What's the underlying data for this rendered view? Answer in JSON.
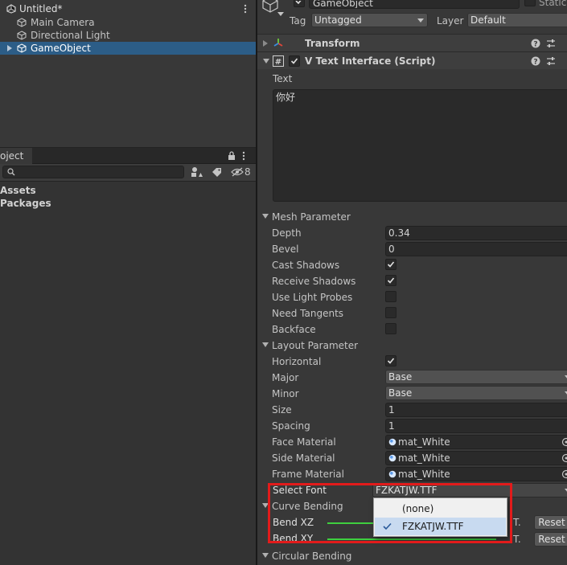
{
  "hierarchy": {
    "scene_name": "Untitled*",
    "items": [
      {
        "label": "Main Camera",
        "icon": "gameobject-cube-icon"
      },
      {
        "label": "Directional Light",
        "icon": "gameobject-cube-icon"
      },
      {
        "label": "GameObject",
        "icon": "gameobject-cube-icon",
        "selected": true
      }
    ]
  },
  "project": {
    "tab_label": "oject",
    "search_placeholder": "",
    "hidden_count": "8",
    "roots": [
      "Assets",
      "Packages"
    ]
  },
  "inspector": {
    "object_name": "GameObject",
    "static_label": "Static",
    "tag_label": "Tag",
    "tag_value": "Untagged",
    "layer_label": "Layer",
    "layer_value": "Default",
    "components": {
      "transform_title": "Transform",
      "script_title": "V Text Interface (Script)"
    },
    "text_label": "Text",
    "text_value": "你好",
    "mesh": {
      "header": "Mesh Parameter",
      "depth_label": "Depth",
      "depth_value": "0.34",
      "bevel_label": "Bevel",
      "bevel_value": "0",
      "cast_shadows_label": "Cast Shadows",
      "cast_shadows": true,
      "receive_shadows_label": "Receive Shadows",
      "receive_shadows": true,
      "light_probes_label": "Use Light Probes",
      "light_probes": false,
      "tangents_label": "Need Tangents",
      "tangents": false,
      "backface_label": "Backface",
      "backface": false
    },
    "layout": {
      "header": "Layout Parameter",
      "horizontal_label": "Horizontal",
      "horizontal": true,
      "major_label": "Major",
      "major_value": "Base",
      "minor_label": "Minor",
      "minor_value": "Base",
      "size_label": "Size",
      "size_value": "1",
      "spacing_label": "Spacing",
      "spacing_value": "1",
      "face_material_label": "Face Material",
      "face_material": "mat_White",
      "side_material_label": "Side Material",
      "side_material": "mat_White",
      "frame_material_label": "Frame Material",
      "frame_material": "mat_White",
      "select_font_label": "Select Font",
      "select_font_value": "FZKATJW.TTF"
    },
    "curve": {
      "header": "Curve Bending",
      "bend_xz_label": "Bend XZ",
      "bend_xy_label": "Bend XY",
      "curve_suffix": "T.",
      "reset_label": "Reset"
    },
    "circular_header": "Circular Bending"
  },
  "font_popup": {
    "options": [
      {
        "label": "(none)",
        "selected": false
      },
      {
        "label": "FZKATJW.TTF",
        "selected": true
      }
    ],
    "highlight_color": "#e21b1b"
  },
  "colors": {
    "selection": "#2c5d87",
    "curve_green": "#3fcf3f",
    "background": "#383838"
  }
}
